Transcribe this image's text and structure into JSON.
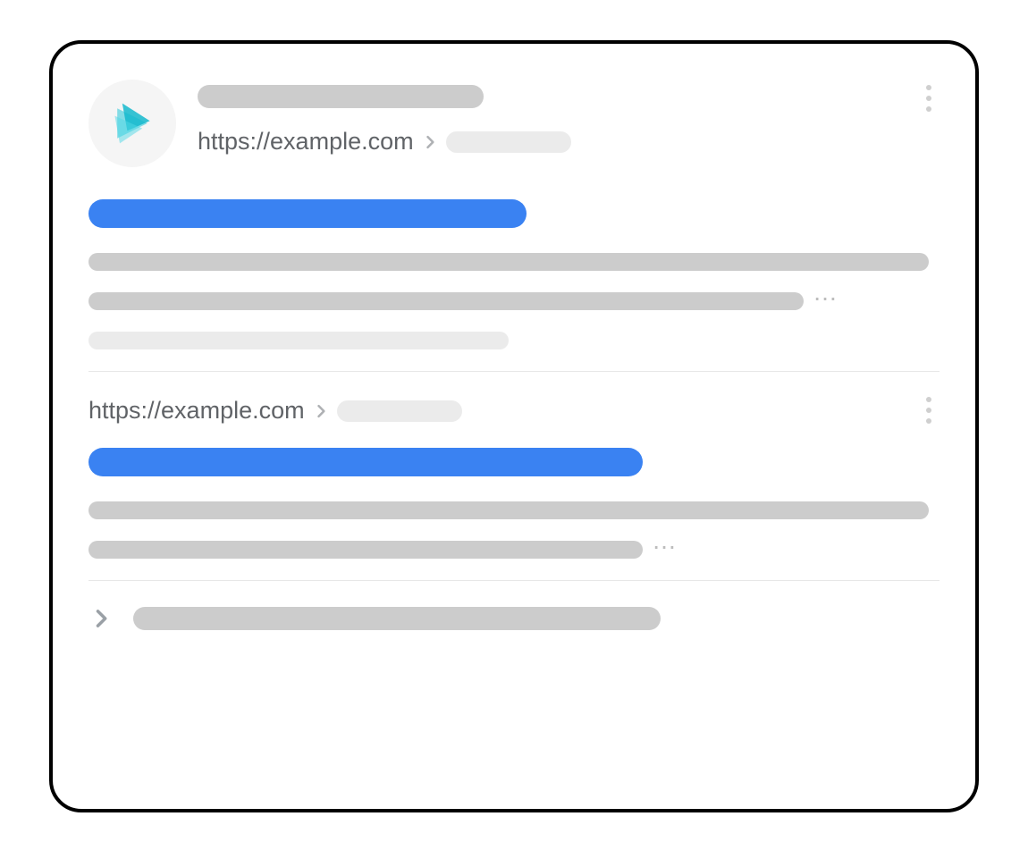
{
  "colors": {
    "link_blue": "#3a82f2",
    "placeholder_gray": "#cccccc",
    "placeholder_light": "#ebebeb"
  },
  "results": [
    {
      "url": "https://example.com",
      "has_favicon": true,
      "site_name_placeholder_width": 320,
      "breadcrumb_placeholder_width": 140,
      "title_placeholder_width": 490,
      "snippet_line_widths": [
        940,
        800,
        470
      ],
      "snippet_line_colors": [
        "#cccccc",
        "#cccccc",
        "#ebebeb"
      ],
      "ellipsis_after_line_index": 1
    },
    {
      "url": "https://example.com",
      "has_favicon": false,
      "breadcrumb_placeholder_width": 140,
      "title_placeholder_width": 620,
      "snippet_line_widths": [
        940,
        620
      ],
      "snippet_line_colors": [
        "#cccccc",
        "#cccccc"
      ],
      "ellipsis_after_line_index": 1
    }
  ],
  "expander": {
    "pill_width": 590
  }
}
